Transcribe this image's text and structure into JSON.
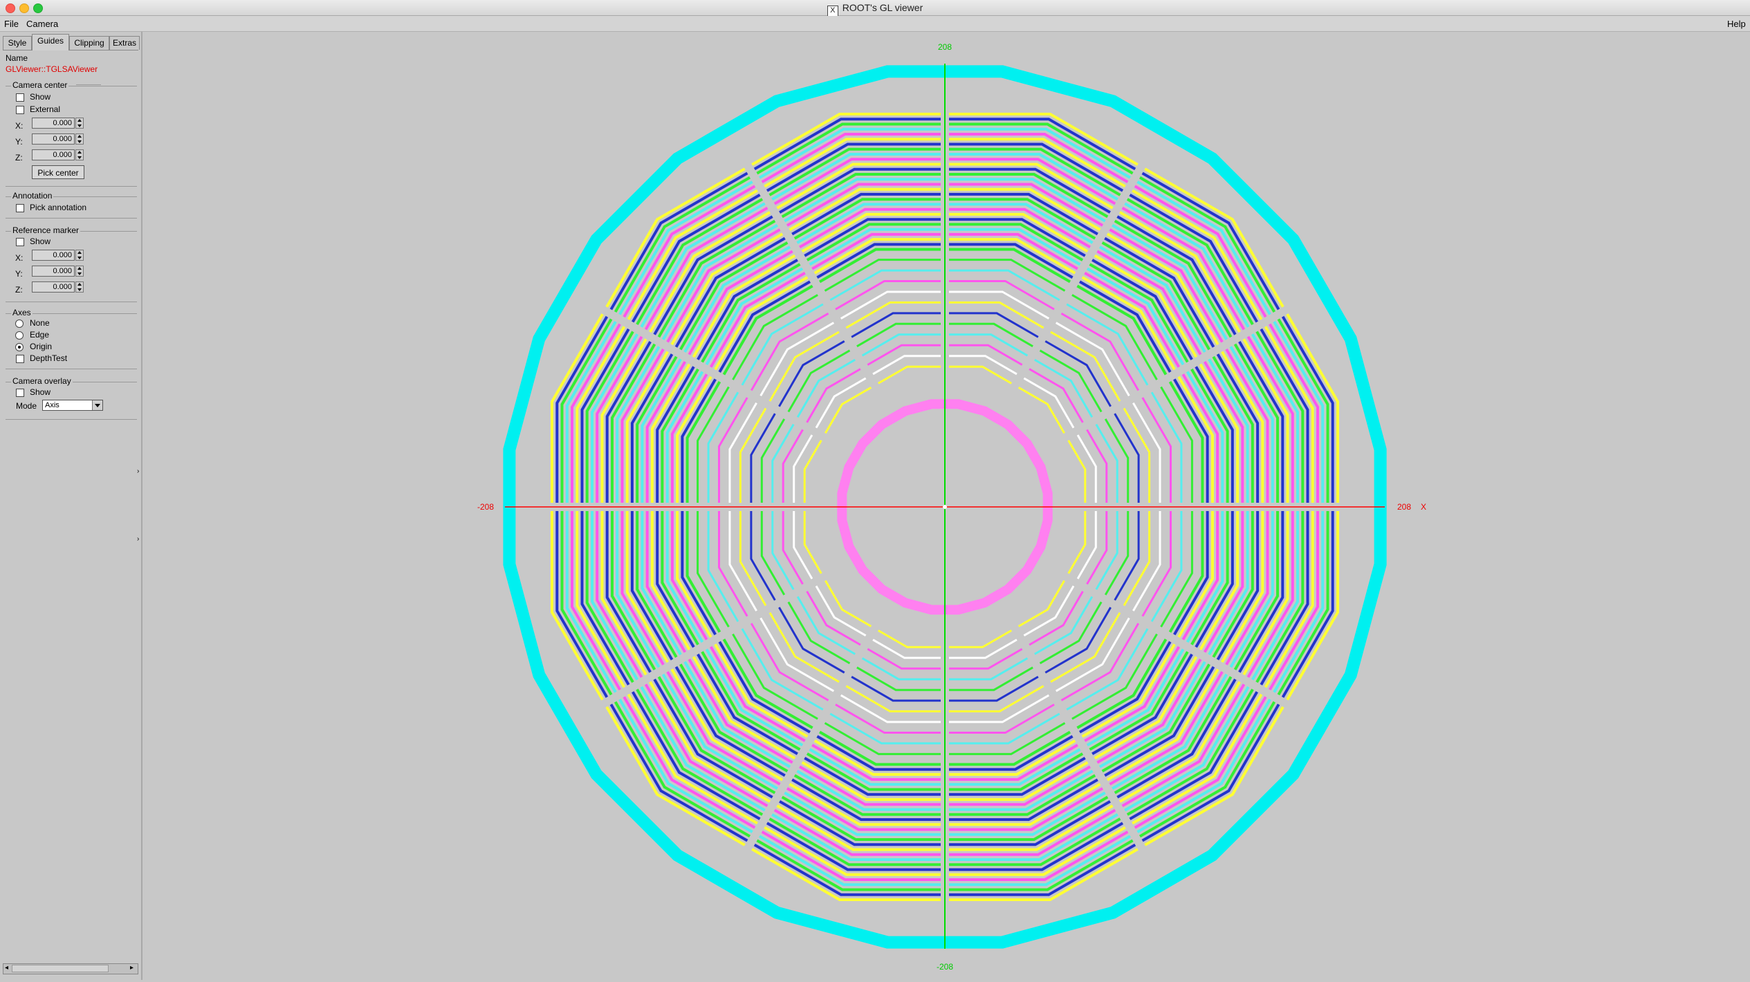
{
  "window": {
    "title": "ROOT's GL viewer"
  },
  "menubar": {
    "file": "File",
    "camera": "Camera",
    "help": "Help"
  },
  "tabs": [
    "Style",
    "Guides",
    "Clipping",
    "Extras"
  ],
  "name_section": {
    "label": "Name",
    "value": "GLViewer::TGLSAViewer"
  },
  "camera_center": {
    "title": "Camera center",
    "show_label": "Show",
    "show_checked": false,
    "external_label": "External",
    "external_checked": false,
    "x_label": "X:",
    "x": "0.000",
    "y_label": "Y:",
    "y": "0.000",
    "z_label": "Z:",
    "z": "0.000",
    "pick_button": "Pick center"
  },
  "annotation": {
    "title": "Annotation",
    "pick_label": "Pick annotation",
    "pick_checked": false
  },
  "reference_marker": {
    "title": "Reference marker",
    "show_label": "Show",
    "show_checked": false,
    "x_label": "X:",
    "x": "0.000",
    "y_label": "Y:",
    "y": "0.000",
    "z_label": "Z:",
    "z": "0.000"
  },
  "axes": {
    "title": "Axes",
    "options": [
      "None",
      "Edge",
      "Origin"
    ],
    "selected": "Origin",
    "depthtest_label": "DepthTest",
    "depthtest_checked": false
  },
  "camera_overlay": {
    "title": "Camera overlay",
    "show_label": "Show",
    "show_checked": false,
    "mode_label": "Mode",
    "mode_value": "Axis"
  },
  "viewport": {
    "axis_y_max": "208",
    "axis_y_min": "-208",
    "axis_x_min": "-208",
    "axis_x_max": "208",
    "axis_x_name": "X",
    "colors": {
      "background": "#c8c8c8",
      "outer_ring": "#00f0f0",
      "inner_ring": "#ff80f0",
      "x_axis": "#ff0000",
      "y_axis": "#00dd00",
      "layer_palette": [
        "#ffff33",
        "#2233cc",
        "#33ee33",
        "#55eeee",
        "#ff55ee",
        "#ffffff"
      ]
    }
  }
}
